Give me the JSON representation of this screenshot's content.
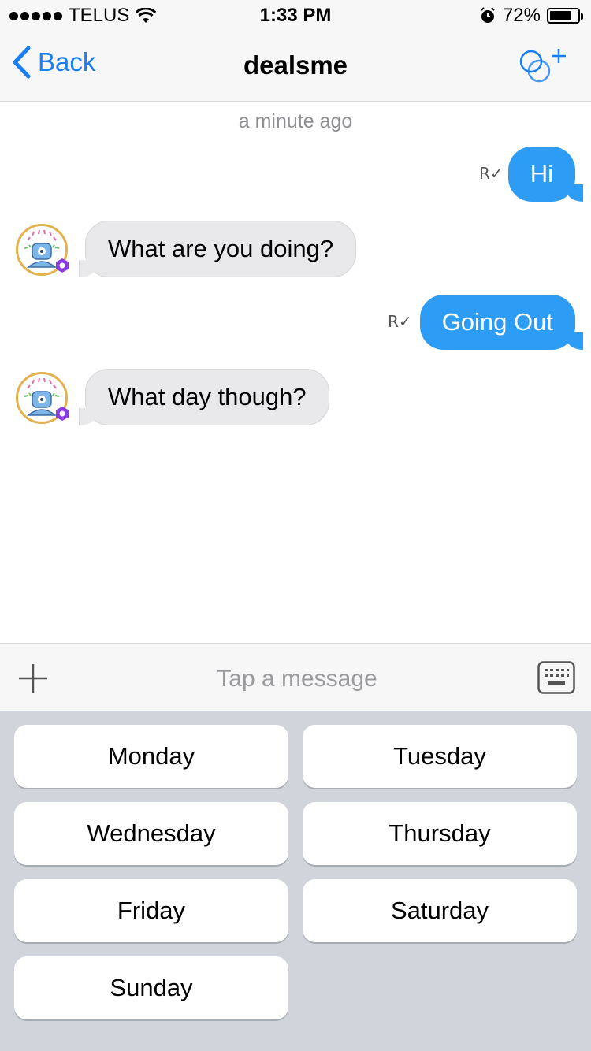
{
  "status_bar": {
    "carrier": "TELUS",
    "time": "1:33 PM",
    "battery": "72%"
  },
  "nav": {
    "back_label": "Back",
    "title": "dealsme"
  },
  "chat": {
    "timestamp": "a minute ago",
    "read_marker": "R",
    "messages": [
      {
        "direction": "outgoing",
        "text": "Hi"
      },
      {
        "direction": "incoming",
        "text": "What are you doing?"
      },
      {
        "direction": "outgoing",
        "text": "Going Out"
      },
      {
        "direction": "incoming",
        "text": "What day though?"
      }
    ]
  },
  "composer": {
    "placeholder": "Tap a message"
  },
  "quick_replies": [
    "Monday",
    "Tuesday",
    "Wednesday",
    "Thursday",
    "Friday",
    "Saturday",
    "Sunday"
  ],
  "colors": {
    "accent": "#1a7ef5",
    "outgoing_bubble": "#2d9cf5",
    "incoming_bubble": "#e9e9eb",
    "replies_background": "#d1d5db"
  }
}
